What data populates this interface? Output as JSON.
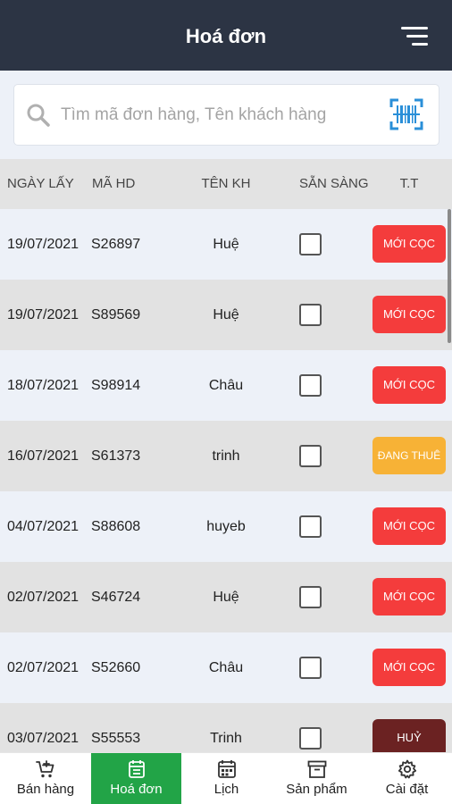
{
  "header": {
    "title": "Hoá đơn",
    "menu_icon": "menu-icon"
  },
  "search": {
    "placeholder": "Tìm mã đơn hàng, Tên khách hàng",
    "value": "",
    "icon": "search-icon",
    "scan_icon": "barcode-scan-icon"
  },
  "table": {
    "columns": [
      "NGÀY LẤY",
      "MÃ HD",
      "TÊN KH",
      "SẴN SÀNG",
      "T.T"
    ],
    "rows": [
      {
        "date": "19/07/2021",
        "code": "S26897",
        "customer": "Huệ",
        "ready": false,
        "status": "MỚI CỌC",
        "status_color": "#f43c3c"
      },
      {
        "date": "19/07/2021",
        "code": "S89569",
        "customer": "Huệ",
        "ready": false,
        "status": "MỚI CỌC",
        "status_color": "#f43c3c"
      },
      {
        "date": "18/07/2021",
        "code": "S98914",
        "customer": "Châu",
        "ready": false,
        "status": "MỚI CỌC",
        "status_color": "#f43c3c"
      },
      {
        "date": "16/07/2021",
        "code": "S61373",
        "customer": "trinh",
        "ready": false,
        "status": "ĐANG THUÊ",
        "status_color": "#f7b236"
      },
      {
        "date": "04/07/2021",
        "code": "S88608",
        "customer": "huyeb",
        "ready": false,
        "status": "MỚI CỌC",
        "status_color": "#f43c3c"
      },
      {
        "date": "02/07/2021",
        "code": "S46724",
        "customer": "Huệ",
        "ready": false,
        "status": "MỚI CỌC",
        "status_color": "#f43c3c"
      },
      {
        "date": "02/07/2021",
        "code": "S52660",
        "customer": "Châu",
        "ready": false,
        "status": "MỚI CỌC",
        "status_color": "#f43c3c"
      },
      {
        "date": "03/07/2021",
        "code": "S55553",
        "customer": "Trinh",
        "ready": false,
        "status": "HUỶ",
        "status_color": "#6b2222"
      }
    ]
  },
  "nav": {
    "items": [
      {
        "label": "Bán hàng",
        "icon": "cart-icon",
        "active": false
      },
      {
        "label": "Hoá đơn",
        "icon": "invoice-icon",
        "active": true
      },
      {
        "label": "Lịch",
        "icon": "calendar-icon",
        "active": false
      },
      {
        "label": "Sản phẩm",
        "icon": "archive-box-icon",
        "active": false
      },
      {
        "label": "Cài đặt",
        "icon": "gear-icon",
        "active": false
      }
    ]
  },
  "colors": {
    "header_bg": "#2c3444",
    "accent_green": "#22a447",
    "new_deposit_red": "#f43c3c",
    "renting_orange": "#f7b236",
    "cancelled_brown": "#6b2222",
    "scan_blue": "#2a8fd8"
  }
}
